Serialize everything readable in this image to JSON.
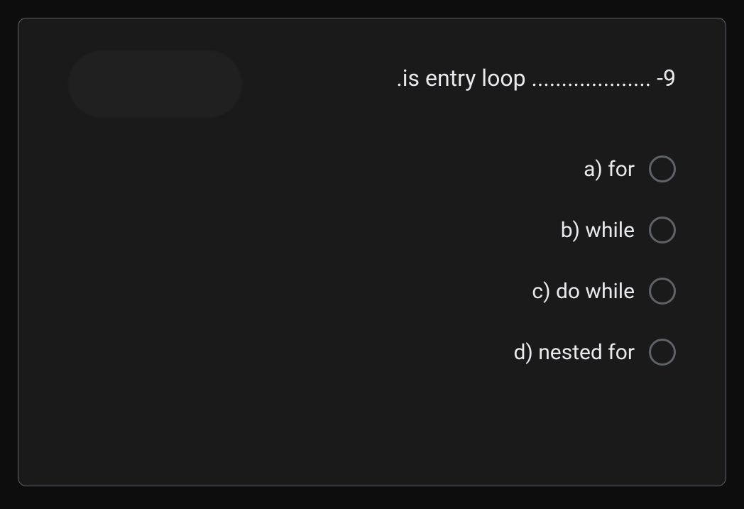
{
  "question": {
    "number": "-9",
    "text": ".is entry loop ....................",
    "full_text": ".is entry loop .................... -9"
  },
  "options": [
    {
      "id": "a",
      "label": "a) for"
    },
    {
      "id": "b",
      "label": "b) while"
    },
    {
      "id": "c",
      "label": "c) do while"
    },
    {
      "id": "d",
      "label": "d) nested for"
    }
  ]
}
